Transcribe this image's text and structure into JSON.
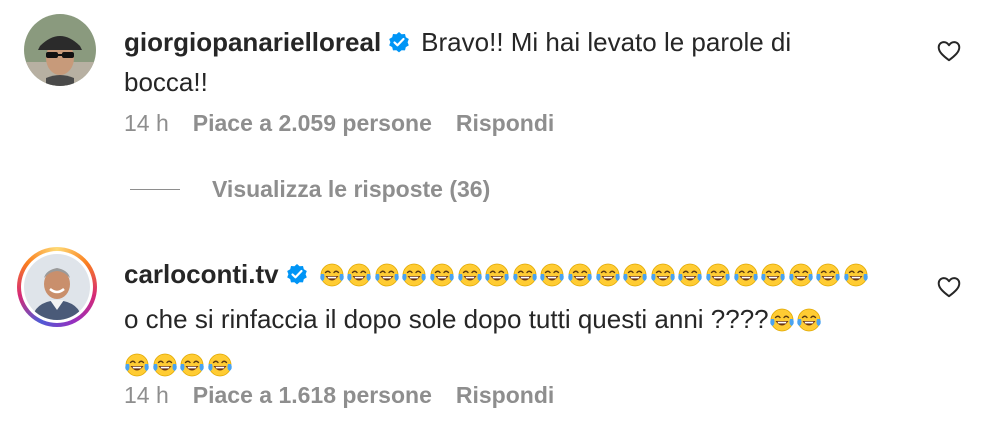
{
  "comments": [
    {
      "username": "giorgiopanarielloreal",
      "verified": true,
      "text_line1": "Bravo!! Mi hai levato le parole di",
      "text_line2": "bocca!!",
      "time": "14 h",
      "likes": "Piace a 2.059 persone",
      "reply": "Rispondi",
      "avatar_icon": "avatar-cap-sunglasses"
    },
    {
      "username": "carloconti.tv",
      "verified": true,
      "emoji_name": "face-with-tears-of-joy",
      "emoji_count_line1": 20,
      "text_line2": "o che si rinfaccia il dopo sole dopo tutti questi anni ????",
      "emoji_count_line2": 2,
      "emoji_count_line3": 4,
      "time": "14 h",
      "likes": "Piace a 1.618 persone",
      "reply": "Rispondi",
      "avatar_icon": "avatar-smiling-man",
      "has_story_ring": true
    }
  ],
  "view_replies": "Visualizza le risposte (36)",
  "colors": {
    "text": "#262626",
    "secondary": "#8e8e8e",
    "verified": "#0095f6"
  }
}
